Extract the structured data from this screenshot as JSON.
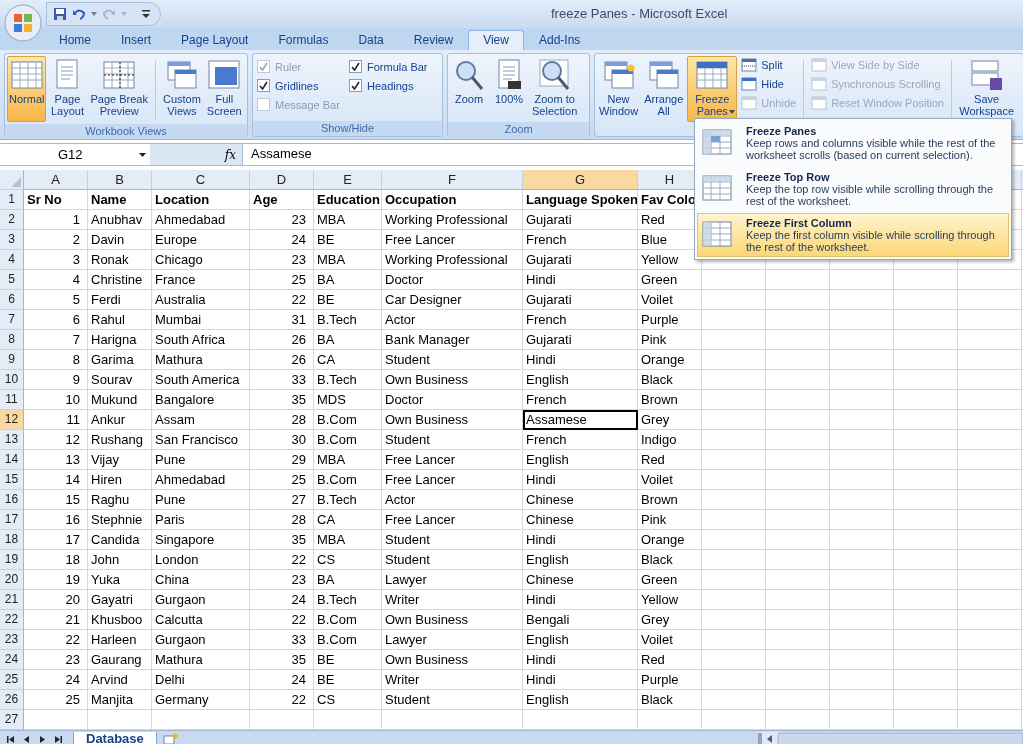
{
  "window": {
    "title": "freeze Panes - Microsoft Excel"
  },
  "tabs": [
    {
      "label": "Home",
      "selected": false
    },
    {
      "label": "Insert",
      "selected": false
    },
    {
      "label": "Page Layout",
      "selected": false
    },
    {
      "label": "Formulas",
      "selected": false
    },
    {
      "label": "Data",
      "selected": false
    },
    {
      "label": "Review",
      "selected": false
    },
    {
      "label": "View",
      "selected": true
    },
    {
      "label": "Add-Ins",
      "selected": false
    }
  ],
  "ribbon": {
    "groups": [
      {
        "label": "Workbook Views",
        "items": [
          {
            "kind": "large",
            "label": "Normal",
            "selected": true
          },
          {
            "kind": "large",
            "label": "Page\nLayout",
            "selected": false
          },
          {
            "kind": "large",
            "label": "Page Break\nPreview",
            "selected": false
          },
          {
            "kind": "separator"
          },
          {
            "kind": "large",
            "label": "Custom\nViews",
            "selected": false
          },
          {
            "kind": "large",
            "label": "Full\nScreen",
            "selected": false
          }
        ]
      },
      {
        "label": "Show/Hide",
        "items": [
          {
            "kind": "checks",
            "items": [
              {
                "label": "Ruler",
                "checked": true,
                "disabled": true
              },
              {
                "label": "Formula Bar",
                "checked": true,
                "disabled": false
              },
              {
                "label": "Gridlines",
                "checked": true,
                "disabled": false
              },
              {
                "label": "Headings",
                "checked": true,
                "disabled": false
              },
              {
                "label": "Message Bar",
                "checked": false,
                "disabled": true
              }
            ]
          }
        ]
      },
      {
        "label": "Zoom",
        "items": [
          {
            "kind": "large",
            "label": "Zoom",
            "selected": false
          },
          {
            "kind": "large",
            "label": "100%",
            "selected": false
          },
          {
            "kind": "large",
            "label": "Zoom to\nSelection",
            "selected": false
          }
        ]
      },
      {
        "items": [
          {
            "kind": "large",
            "label": "New\nWindow",
            "selected": false
          },
          {
            "kind": "large",
            "label": "Arrange\nAll",
            "selected": false
          },
          {
            "kind": "large",
            "label": "Freeze\nPanes",
            "selected": true,
            "menu": true
          },
          {
            "kind": "stack",
            "items": [
              {
                "label": "Split",
                "disabled": false
              },
              {
                "label": "Hide",
                "disabled": false
              },
              {
                "label": "Unhide",
                "disabled": true
              }
            ]
          },
          {
            "kind": "separator"
          },
          {
            "kind": "stack",
            "items": [
              {
                "label": "View Side by Side",
                "disabled": true
              },
              {
                "label": "Synchronous Scrolling",
                "disabled": true
              },
              {
                "label": "Reset Window Position",
                "disabled": true
              }
            ]
          },
          {
            "kind": "separator"
          },
          {
            "kind": "large",
            "label": "Save\nWorkspace",
            "selected": false
          }
        ]
      }
    ]
  },
  "formula_bar": {
    "name_box": "G12",
    "function_label": "fx",
    "value": "Assamese"
  },
  "sheet": {
    "columns": [
      {
        "letter": "A",
        "numeric": true,
        "selected": false
      },
      {
        "letter": "B",
        "numeric": false,
        "selected": false
      },
      {
        "letter": "C",
        "numeric": false,
        "selected": false
      },
      {
        "letter": "D",
        "numeric": true,
        "selected": false
      },
      {
        "letter": "E",
        "numeric": false,
        "selected": false
      },
      {
        "letter": "F",
        "numeric": false,
        "selected": false
      },
      {
        "letter": "G",
        "numeric": false,
        "selected": true
      },
      {
        "letter": "H",
        "numeric": false,
        "selected": false
      }
    ],
    "rows": [
      {
        "n": "1",
        "kind": "header",
        "selected": false,
        "cells": [
          "Sr No",
          "Name",
          "Location",
          "Age",
          "Education",
          "Occupation",
          "Language Spoken",
          "Fav Colo"
        ]
      },
      {
        "n": "2",
        "kind": "data",
        "selected": false,
        "cells": [
          "1",
          "Anubhav",
          "Ahmedabad",
          "23",
          "MBA",
          "Working Professional",
          "Gujarati",
          "Red"
        ]
      },
      {
        "n": "3",
        "kind": "data",
        "selected": false,
        "cells": [
          "2",
          "Davin",
          "Europe",
          "24",
          "BE",
          "Free Lancer",
          "French",
          "Blue"
        ]
      },
      {
        "n": "4",
        "kind": "data",
        "selected": false,
        "cells": [
          "3",
          "Ronak",
          "Chicago",
          "23",
          "MBA",
          "Working Professional",
          "Gujarati",
          "Yellow"
        ]
      },
      {
        "n": "5",
        "kind": "data",
        "selected": false,
        "cells": [
          "4",
          "Christine",
          "France",
          "25",
          "BA",
          "Doctor",
          "Hindi",
          "Green"
        ]
      },
      {
        "n": "6",
        "kind": "data",
        "selected": false,
        "cells": [
          "5",
          "Ferdi",
          "Australia",
          "22",
          "BE",
          "Car Designer",
          "Gujarati",
          "Voilet"
        ]
      },
      {
        "n": "7",
        "kind": "data",
        "selected": false,
        "cells": [
          "6",
          "Rahul",
          "Mumbai",
          "31",
          "B.Tech",
          "Actor",
          "French",
          "Purple"
        ]
      },
      {
        "n": "8",
        "kind": "data",
        "selected": false,
        "cells": [
          "7",
          "Harigna",
          "South Africa",
          "26",
          "BA",
          "Bank Manager",
          "Gujarati",
          "Pink"
        ]
      },
      {
        "n": "9",
        "kind": "data",
        "selected": false,
        "cells": [
          "8",
          "Garima",
          "Mathura",
          "26",
          "CA",
          "Student",
          "Hindi",
          "Orange"
        ]
      },
      {
        "n": "10",
        "kind": "data",
        "selected": false,
        "cells": [
          "9",
          "Sourav",
          "South America",
          "33",
          "B.Tech",
          "Own Business",
          "English",
          "Black"
        ]
      },
      {
        "n": "11",
        "kind": "data",
        "selected": false,
        "cells": [
          "10",
          "Mukund",
          "Bangalore",
          "35",
          "MDS",
          "Doctor",
          "French",
          "Brown"
        ]
      },
      {
        "n": "12",
        "kind": "data",
        "selected": true,
        "cells": [
          "11",
          "Ankur",
          "Assam",
          "28",
          "B.Com",
          "Own Business",
          "Assamese",
          "Grey"
        ]
      },
      {
        "n": "13",
        "kind": "data",
        "selected": false,
        "cells": [
          "12",
          "Rushang",
          "San Francisco",
          "30",
          "B.Com",
          "Student",
          "French",
          "Indigo"
        ]
      },
      {
        "n": "14",
        "kind": "data",
        "selected": false,
        "cells": [
          "13",
          "Vijay",
          "Pune",
          "29",
          "MBA",
          "Free Lancer",
          "English",
          "Red"
        ]
      },
      {
        "n": "15",
        "kind": "data",
        "selected": false,
        "cells": [
          "14",
          "Hiren",
          "Ahmedabad",
          "25",
          "B.Com",
          "Free Lancer",
          "Hindi",
          "Voilet"
        ]
      },
      {
        "n": "16",
        "kind": "data",
        "selected": false,
        "cells": [
          "15",
          "Raghu",
          "Pune",
          "27",
          "B.Tech",
          "Actor",
          "Chinese",
          "Brown"
        ]
      },
      {
        "n": "17",
        "kind": "data",
        "selected": false,
        "cells": [
          "16",
          "Stephnie",
          "Paris",
          "28",
          "CA",
          "Free Lancer",
          "Chinese",
          "Pink"
        ]
      },
      {
        "n": "18",
        "kind": "data",
        "selected": false,
        "cells": [
          "17",
          "Candida",
          "Singapore",
          "35",
          "MBA",
          "Student",
          "Hindi",
          "Orange"
        ]
      },
      {
        "n": "19",
        "kind": "data",
        "selected": false,
        "cells": [
          "18",
          "John",
          "London",
          "22",
          "CS",
          "Student",
          "English",
          "Black"
        ]
      },
      {
        "n": "20",
        "kind": "data",
        "selected": false,
        "cells": [
          "19",
          "Yuka",
          "China",
          "23",
          "BA",
          "Lawyer",
          "Chinese",
          "Green"
        ]
      },
      {
        "n": "21",
        "kind": "data",
        "selected": false,
        "cells": [
          "20",
          "Gayatri",
          "Gurgaon",
          "24",
          "B.Tech",
          "Writer",
          "Hindi",
          "Yellow"
        ]
      },
      {
        "n": "22",
        "kind": "data",
        "selected": false,
        "cells": [
          "21",
          "Khusboo",
          "Calcutta",
          "22",
          "B.Com",
          "Own Business",
          "Bengali",
          "Grey"
        ]
      },
      {
        "n": "23",
        "kind": "data",
        "selected": false,
        "cells": [
          "22",
          "Harleen",
          "Gurgaon",
          "33",
          "B.Com",
          "Lawyer",
          "English",
          "Voilet"
        ]
      },
      {
        "n": "24",
        "kind": "data",
        "selected": false,
        "cells": [
          "23",
          "Gaurang",
          "Mathura",
          "35",
          "BE",
          "Own Business",
          "Hindi",
          "Red"
        ]
      },
      {
        "n": "25",
        "kind": "data",
        "selected": false,
        "cells": [
          "24",
          "Arvind",
          "Delhi",
          "24",
          "BE",
          "Writer",
          "Hindi",
          "Purple"
        ]
      },
      {
        "n": "26",
        "kind": "data",
        "selected": false,
        "cells": [
          "25",
          "Manjita",
          "Germany",
          "22",
          "CS",
          "Student",
          "English",
          "Black"
        ]
      },
      {
        "n": "27",
        "kind": "data",
        "selected": false
      }
    ]
  },
  "freeze_menu": {
    "items": [
      {
        "title": "Freeze Panes",
        "description": "Keep rows and columns visible while the rest of the worksheet scrolls (based on current selection).",
        "selected": false
      },
      {
        "title": "Freeze Top Row",
        "description": "Keep the top row visible while scrolling through the rest of the worksheet.",
        "selected": false
      },
      {
        "title": "Freeze First Column",
        "description": "Keep the first column visible while scrolling through the rest of the worksheet.",
        "selected": true
      }
    ]
  },
  "sheet_tabs": [
    {
      "label": "Database",
      "selected": true
    }
  ]
}
